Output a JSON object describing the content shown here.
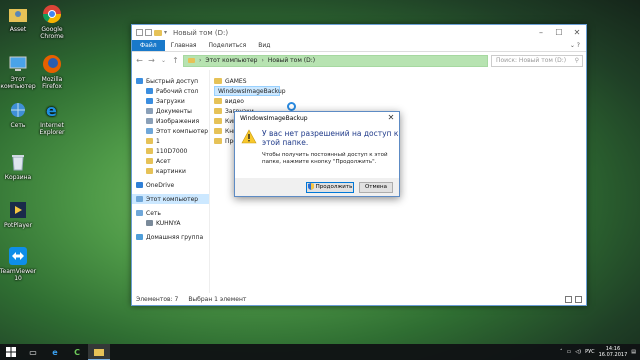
{
  "desktop": {
    "icons": [
      {
        "label": "Asset",
        "icon": "folder-user-icon"
      },
      {
        "label": "Google Chrome",
        "icon": "chrome-icon"
      },
      {
        "label": "Этот компьютер",
        "icon": "computer-icon"
      },
      {
        "label": "Mozilla Firefox",
        "icon": "firefox-icon"
      },
      {
        "label": "Сеть",
        "icon": "network-icon"
      },
      {
        "label": "Internet Explorer",
        "icon": "ie-icon"
      },
      {
        "label": "Корзина",
        "icon": "recycle-bin-icon"
      },
      {
        "label": "PotPlayer",
        "icon": "potplayer-icon"
      },
      {
        "label": "TeamViewer 10",
        "icon": "teamviewer-icon"
      }
    ]
  },
  "explorer": {
    "title": "Новый том (D:)",
    "ribbon": {
      "file": "Файл",
      "home": "Главная",
      "share": "Поделиться",
      "view": "Вид"
    },
    "address": {
      "part1": "Этот компьютер",
      "part2": "Новый том (D:)"
    },
    "search_placeholder": "Поиск: Новый том (D:)",
    "nav": [
      {
        "label": "Быстрый доступ",
        "indent": 0,
        "color": "#3b8ee0"
      },
      {
        "label": "Рабочий стол",
        "indent": 1,
        "color": "#3b8ee0"
      },
      {
        "label": "Загрузки",
        "indent": 1,
        "color": "#3b8ee0"
      },
      {
        "label": "Документы",
        "indent": 1,
        "color": "#8aa0b8"
      },
      {
        "label": "Изображения",
        "indent": 1,
        "color": "#8aa0b8"
      },
      {
        "label": "Этот компьютер",
        "indent": 1,
        "color": "#6fa7d9"
      },
      {
        "label": "1",
        "indent": 1,
        "color": "#e6c257"
      },
      {
        "label": "110D7000",
        "indent": 1,
        "color": "#e6c257"
      },
      {
        "label": "Асет",
        "indent": 1,
        "color": "#e6c257"
      },
      {
        "label": "картинки",
        "indent": 1,
        "color": "#e6c257"
      },
      {
        "label": "",
        "indent": 0,
        "color": "transparent"
      },
      {
        "label": "OneDrive",
        "indent": 0,
        "color": "#2f7fd6"
      },
      {
        "label": "",
        "indent": 0,
        "color": "transparent"
      },
      {
        "label": "Этот компьютер",
        "indent": 0,
        "color": "#6fa7d9",
        "selected": true
      },
      {
        "label": "",
        "indent": 0,
        "color": "transparent"
      },
      {
        "label": "Сеть",
        "indent": 0,
        "color": "#6fa7d9"
      },
      {
        "label": "KUHNYA",
        "indent": 1,
        "color": "#7a8a9a"
      },
      {
        "label": "",
        "indent": 0,
        "color": "transparent"
      },
      {
        "label": "Домашняя группа",
        "indent": 0,
        "color": "#4f9ed9"
      }
    ],
    "files": [
      {
        "name": "GAMES",
        "selected": false
      },
      {
        "name": "WindowsImageBackup",
        "selected": true
      },
      {
        "name": "видео",
        "selected": false
      },
      {
        "name": "Загрузки",
        "selected": false
      },
      {
        "name": "Кино",
        "selected": false
      },
      {
        "name": "Книги",
        "selected": false
      },
      {
        "name": "Программы",
        "selected": false
      }
    ],
    "status": {
      "count": "Элементов: 7",
      "selected": "Выбран 1 элемент"
    }
  },
  "dialog": {
    "title": "WindowsImageBackup",
    "heading": "У вас нет разрешений на доступ к этой папке.",
    "message": "Чтобы получить постоянный доступ к этой папке, нажмите кнопку \"Продолжить\".",
    "continue_label": "Продолжить",
    "cancel_label": "Отмена"
  },
  "taskbar": {
    "lang": "РУС",
    "time": "14:16",
    "date": "16.07.2017"
  },
  "colors": {
    "accent": "#1979ca",
    "selection": "#cce8ff",
    "folder": "#e6c257"
  }
}
